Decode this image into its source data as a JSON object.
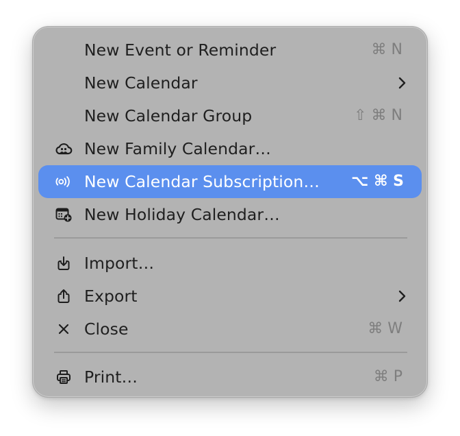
{
  "menu": {
    "items": [
      {
        "label": "New Event or Reminder",
        "shortcut": "⌘ N",
        "icon": null,
        "submenu": false
      },
      {
        "label": "New Calendar",
        "shortcut": "",
        "icon": null,
        "submenu": true
      },
      {
        "label": "New Calendar Group",
        "shortcut": "⇧ ⌘ N",
        "icon": null,
        "submenu": false
      },
      {
        "label": "New Family Calendar…",
        "shortcut": "",
        "icon": "cloud-people-icon",
        "submenu": false
      },
      {
        "label": "New Calendar Subscription…",
        "shortcut": "⌥ ⌘ S",
        "icon": "broadcast-icon",
        "submenu": false,
        "highlighted": true
      },
      {
        "label": "New Holiday Calendar…",
        "shortcut": "",
        "icon": "calendar-add-icon",
        "submenu": false
      },
      {
        "label": "Import…",
        "shortcut": "",
        "icon": "import-icon",
        "submenu": false
      },
      {
        "label": "Export",
        "shortcut": "",
        "icon": "share-icon",
        "submenu": true
      },
      {
        "label": "Close",
        "shortcut": "⌘ W",
        "icon": "close-icon",
        "submenu": false
      },
      {
        "label": "Print…",
        "shortcut": "⌘ P",
        "icon": "printer-icon",
        "submenu": false
      }
    ]
  },
  "colors": {
    "menu_background": "#b3b3b3",
    "highlight": "#5b8fee",
    "text": "#1f1f1f",
    "shortcut_text": "#7e7e7e"
  }
}
